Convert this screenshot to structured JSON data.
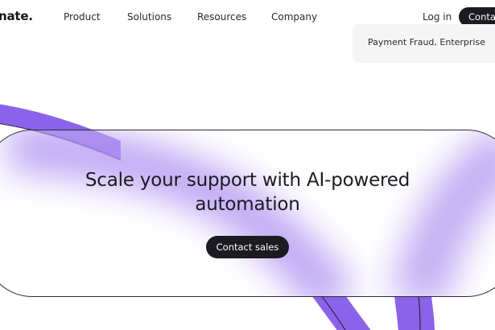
{
  "brand": {
    "logo_text": "nate."
  },
  "nav": {
    "links": [
      "Product",
      "Solutions",
      "Resources",
      "Company"
    ],
    "login_label": "Log in",
    "contact_label": "Contact"
  },
  "dropdown": {
    "item_text": "Payment Fraud, Enterprise"
  },
  "hero": {
    "headline_line1": "Scale your support with AI-powered",
    "headline_line2": "automation",
    "cta_label": "Contact sales"
  },
  "colors": {
    "accent_purple": "#8b63ea",
    "dark": "#1b1b22",
    "card_bg": "#f5f5f6"
  }
}
